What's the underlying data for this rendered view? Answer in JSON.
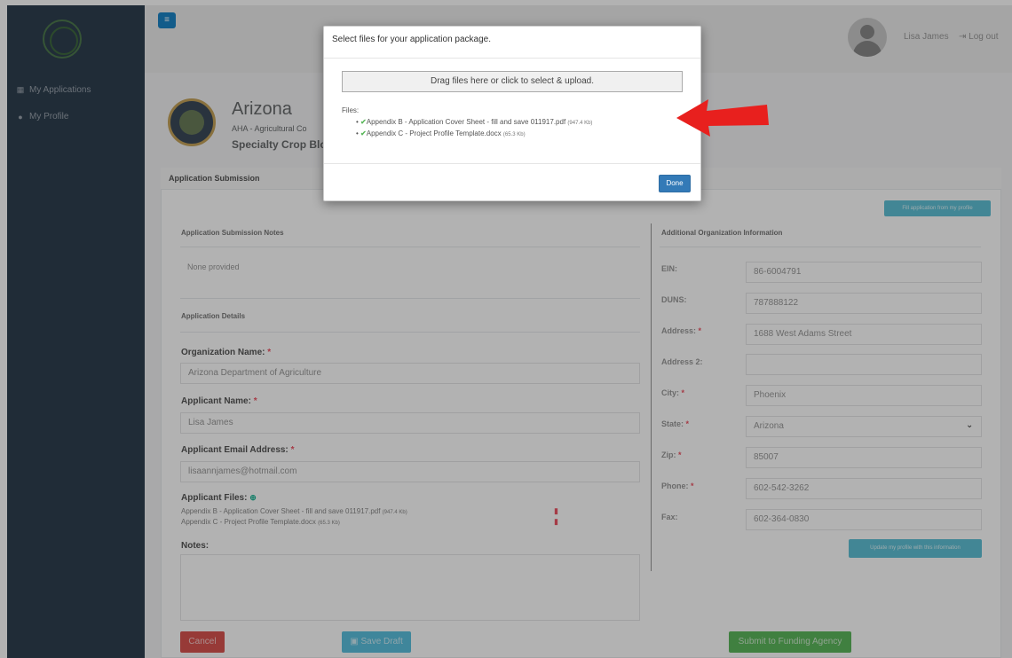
{
  "header": {
    "menu_icon": "bars-icon",
    "user_name": "Lisa James",
    "logout_label": "Log out",
    "logout_icon": "sign-out-icon"
  },
  "sidebar": {
    "items": [
      {
        "label": "My Applications",
        "icon": "th-large-icon"
      },
      {
        "label": "My Profile",
        "icon": "user-icon"
      }
    ]
  },
  "org": {
    "title": "Arizona",
    "subtitle": "AHA - Agricultural Co",
    "program": "Specialty Crop Bloc"
  },
  "card": {
    "title": "Application Submission",
    "fill_button": "Fill application from my profile"
  },
  "left": {
    "notes_section": "Application Submission Notes",
    "notes_value": "None provided",
    "details_section": "Application Details",
    "org_name_label": "Organization Name:",
    "org_name_value": "Arizona Department of Agriculture",
    "applicant_label": "Applicant Name:",
    "applicant_value": "Lisa James",
    "email_label": "Applicant Email Address:",
    "email_value": "lisaannjames@hotmail.com",
    "files_label": "Applicant Files:",
    "files": [
      {
        "name": "Appendix B - Application Cover Sheet - fill and save 011917.pdf",
        "size": "(947.4 Kb)"
      },
      {
        "name": "Appendix C - Project Profile Template.docx",
        "size": "(65.3 Kb)"
      }
    ],
    "notes_label": "Notes:"
  },
  "right": {
    "section": "Additional Organization Information",
    "ein_label": "EIN:",
    "ein_value": "86-6004791",
    "duns_label": "DUNS:",
    "duns_value": "787888122",
    "address_label": "Address:",
    "address_value": "1688 West Adams Street",
    "address2_label": "Address 2:",
    "address2_value": "",
    "city_label": "City:",
    "city_value": "Phoenix",
    "state_label": "State:",
    "state_value": "Arizona",
    "zip_label": "Zip:",
    "zip_value": "85007",
    "phone_label": "Phone:",
    "phone_value": "602-542-3262",
    "fax_label": "Fax:",
    "fax_value": "602-364-0830",
    "update_button": "Update my profile with this information"
  },
  "actions": {
    "cancel": "Cancel",
    "save_draft": "Save Draft",
    "submit": "Submit to Funding Agency"
  },
  "modal": {
    "title": "Select files for your application package.",
    "dropzone": "Drag files here or click to select & upload.",
    "files_label": "Files:",
    "files": [
      {
        "name": "Appendix B - Application Cover Sheet - fill and save 011917.pdf",
        "size": "(947.4 Kb)"
      },
      {
        "name": "Appendix C - Project Profile Template.docx",
        "size": "(65.3 Kb)"
      }
    ],
    "done": "Done"
  },
  "colors": {
    "sidebar": "#2f4050",
    "primary": "#337ab7",
    "danger": "#d9534f",
    "success": "#5cb85c",
    "info": "#5bc0de",
    "arrow": "#e8201e"
  }
}
